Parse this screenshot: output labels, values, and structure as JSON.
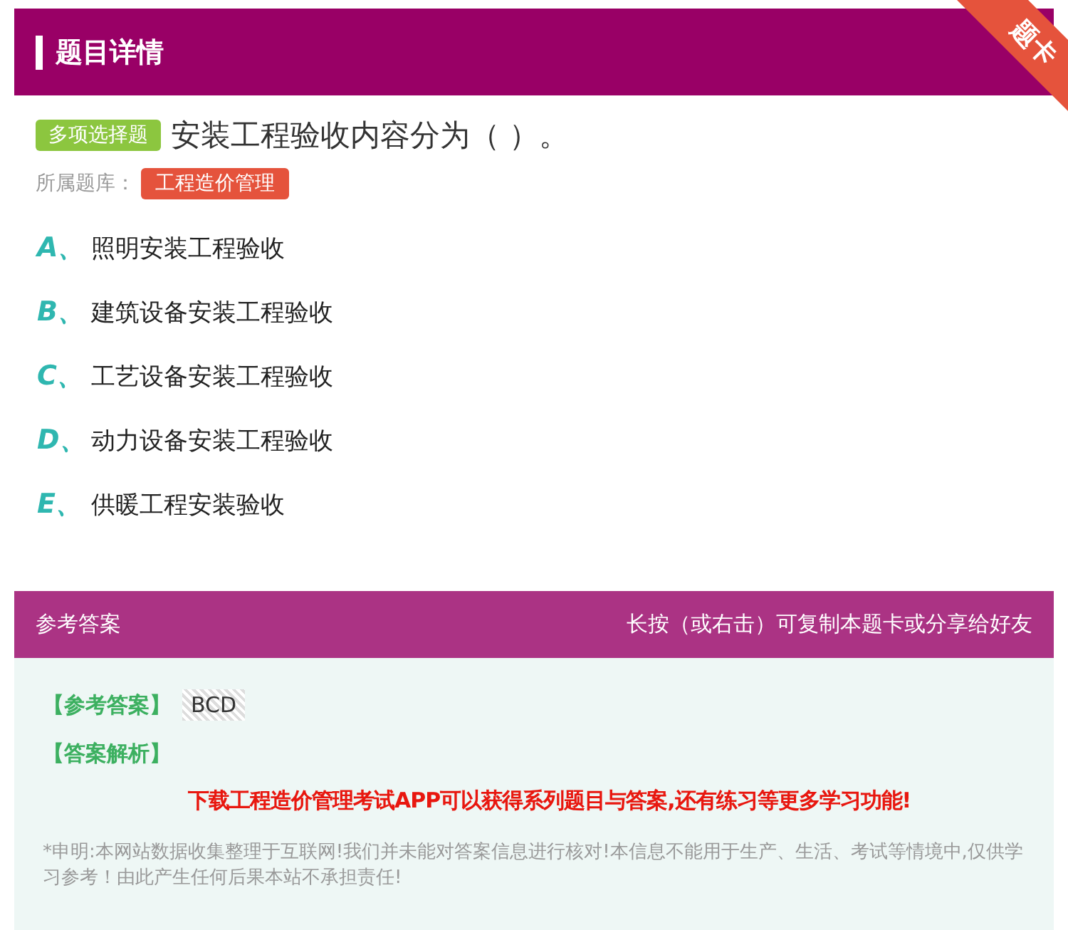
{
  "header": {
    "title": "题目详情",
    "ribbon": "题卡"
  },
  "question": {
    "type_badge": "多项选择题",
    "text": "安装工程验收内容分为（  ）。",
    "bank_label": "所属题库：",
    "bank": "工程造价管理"
  },
  "options": [
    {
      "letter": "A、",
      "text": "照明安装工程验收"
    },
    {
      "letter": "B、",
      "text": "建筑设备安装工程验收"
    },
    {
      "letter": "C、",
      "text": "工艺设备安装工程验收"
    },
    {
      "letter": "D、",
      "text": "动力设备安装工程验收"
    },
    {
      "letter": "E、",
      "text": "供暖工程安装验收"
    }
  ],
  "answer": {
    "title": "参考答案",
    "hint": "长按（或右击）可复制本题卡或分享给好友",
    "answer_label": "【参考答案】",
    "answer_value": "BCD",
    "analysis_label": "【答案解析】",
    "promo": "下载工程造价管理考试APP可以获得系列题目与答案,还有练习等更多学习功能!",
    "disclaimer": "*申明:本网站数据收集整理于互联网!我们并未能对答案信息进行核对!本信息不能用于生产、生活、考试等情境中,仅供学习参考！由此产生任何后果本站不承担责任!"
  }
}
